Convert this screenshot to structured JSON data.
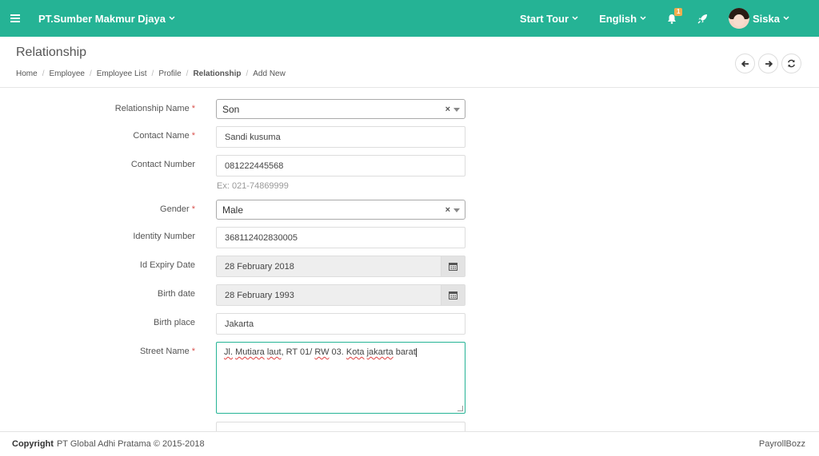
{
  "topbar": {
    "company": "PT.Sumber Makmur Djaya",
    "start_tour": "Start Tour",
    "language": "English",
    "notification_count": "1",
    "user_name": "Siska",
    "accent_color": "#25b395",
    "badge_color": "#f0ad4e"
  },
  "header": {
    "title": "Relationship",
    "breadcrumb": [
      "Home",
      "Employee",
      "Employee List",
      "Profile",
      "Relationship",
      "Add New"
    ]
  },
  "form": {
    "relationship_name": {
      "label": "Relationship Name",
      "value": "Son"
    },
    "contact_name": {
      "label": "Contact Name",
      "value": "Sandi kusuma"
    },
    "contact_number": {
      "label": "Contact Number",
      "value": "081222445568",
      "hint": "Ex: 021-74869999"
    },
    "gender": {
      "label": "Gender",
      "value": "Male"
    },
    "identity_number": {
      "label": "Identity Number",
      "value": "368112402830005"
    },
    "id_expiry_date": {
      "label": "Id Expiry Date",
      "value": "28 February 2018"
    },
    "birth_date": {
      "label": "Birth date",
      "value": "28 February 1993"
    },
    "birth_place": {
      "label": "Birth place",
      "value": "Jakarta"
    },
    "street_name": {
      "label": "Street Name",
      "value_parts": [
        "Jl.",
        " ",
        "Mutiara",
        " ",
        "laut",
        ", RT 01/ ",
        "RW",
        " 03. ",
        "Kota",
        " ",
        "jakarta",
        " barat"
      ]
    }
  },
  "footer": {
    "copyright_label": "Copyright",
    "copyright_text": "PT Global Adhi Pratama © 2015-2018",
    "brand": "PayrollBozz"
  }
}
